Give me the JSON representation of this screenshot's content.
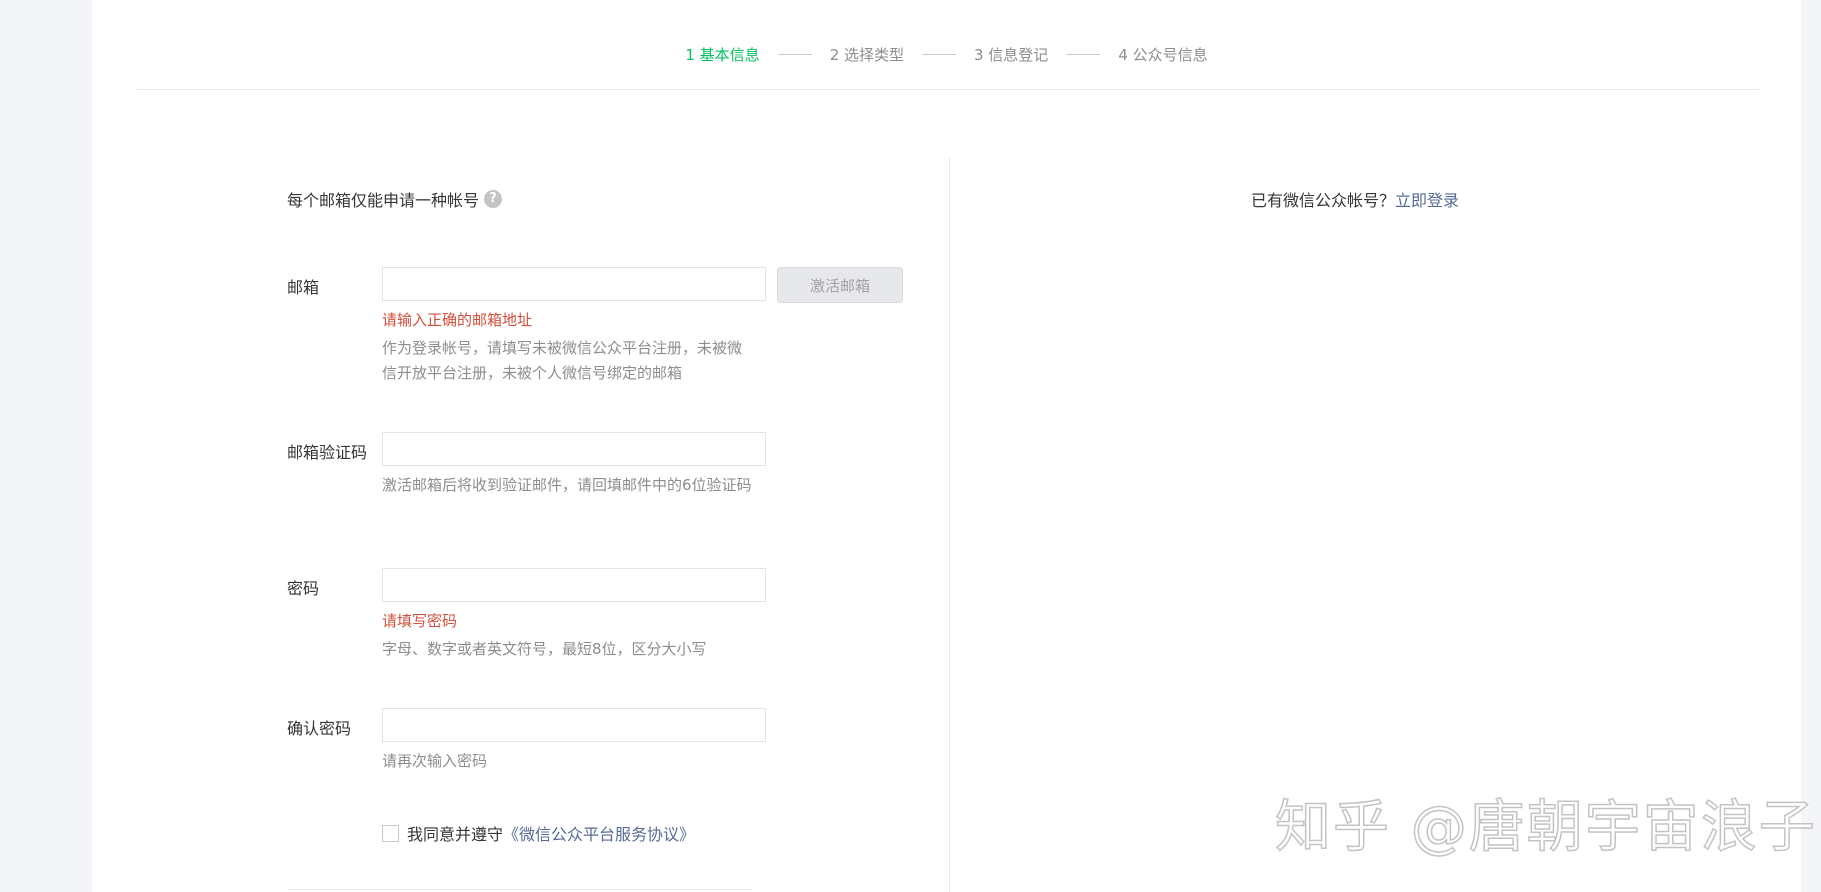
{
  "steps": [
    {
      "label": "1 基本信息",
      "active": true
    },
    {
      "label": "2 选择类型",
      "active": false
    },
    {
      "label": "3 信息登记",
      "active": false
    },
    {
      "label": "4 公众号信息",
      "active": false
    }
  ],
  "form": {
    "notice": "每个邮箱仅能申请一种帐号",
    "email": {
      "label": "邮箱",
      "value": "",
      "activate_label": "激活邮箱",
      "error": "请输入正确的邮箱地址",
      "desc": "作为登录帐号，请填写未被微信公众平台注册，未被微信开放平台注册，未被个人微信号绑定的邮箱"
    },
    "verify": {
      "label": "邮箱验证码",
      "value": "",
      "desc": "激活邮箱后将收到验证邮件，请回填邮件中的6位验证码"
    },
    "password": {
      "label": "密码",
      "value": "",
      "error": "请填写密码",
      "desc": "字母、数字或者英文符号，最短8位，区分大小写"
    },
    "confirm": {
      "label": "确认密码",
      "value": "",
      "desc": "请再次输入密码"
    },
    "agreement": {
      "checked": false,
      "text": "我同意并遵守",
      "link": "《微信公众平台服务协议》"
    }
  },
  "login_hint": {
    "text": "已有微信公众帐号？",
    "link": "立即登录"
  },
  "watermark": "知乎 @唐朝宇宙浪子",
  "colors": {
    "accent": "#07c160",
    "link": "#576b95",
    "error": "#d0503c"
  }
}
